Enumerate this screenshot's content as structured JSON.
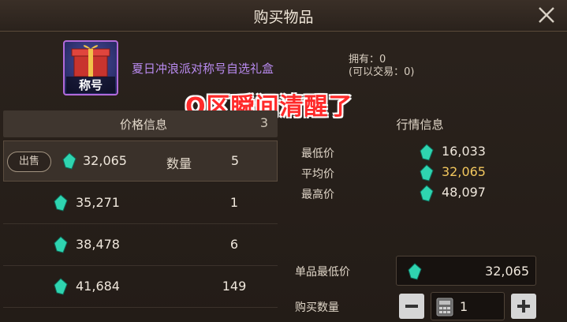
{
  "dialog": {
    "title": "购买物品"
  },
  "item": {
    "badge": "称号",
    "name": "夏日冲浪派对称号自选礼盒",
    "owned": "拥有：0",
    "tradable": "(可以交易：0)"
  },
  "overlay_caption": "Q区瞬间清醒了",
  "price_list": {
    "header_label": "价格信息",
    "header_count": "3",
    "sell_label": "出售",
    "qty_label": "数量",
    "rows": [
      {
        "price": "32,065",
        "qty": "5"
      },
      {
        "price": "35,271",
        "qty": "1"
      },
      {
        "price": "38,478",
        "qty": "6"
      },
      {
        "price": "41,684",
        "qty": "149"
      }
    ]
  },
  "market": {
    "title": "行情信息",
    "rows": [
      {
        "label": "最低价",
        "value": "16,033"
      },
      {
        "label": "平均价",
        "value": "32,065"
      },
      {
        "label": "最高价",
        "value": "48,097"
      }
    ]
  },
  "purchase": {
    "unit_min_label": "单品最低价",
    "unit_min_value": "32,065",
    "quantity_label": "购买数量",
    "quantity_value": "1"
  },
  "colors": {
    "gem": "#2fd4b0",
    "gold_text": "#f2c75e",
    "item_name": "#b98bf0",
    "overlay": "#ff2a2a"
  }
}
